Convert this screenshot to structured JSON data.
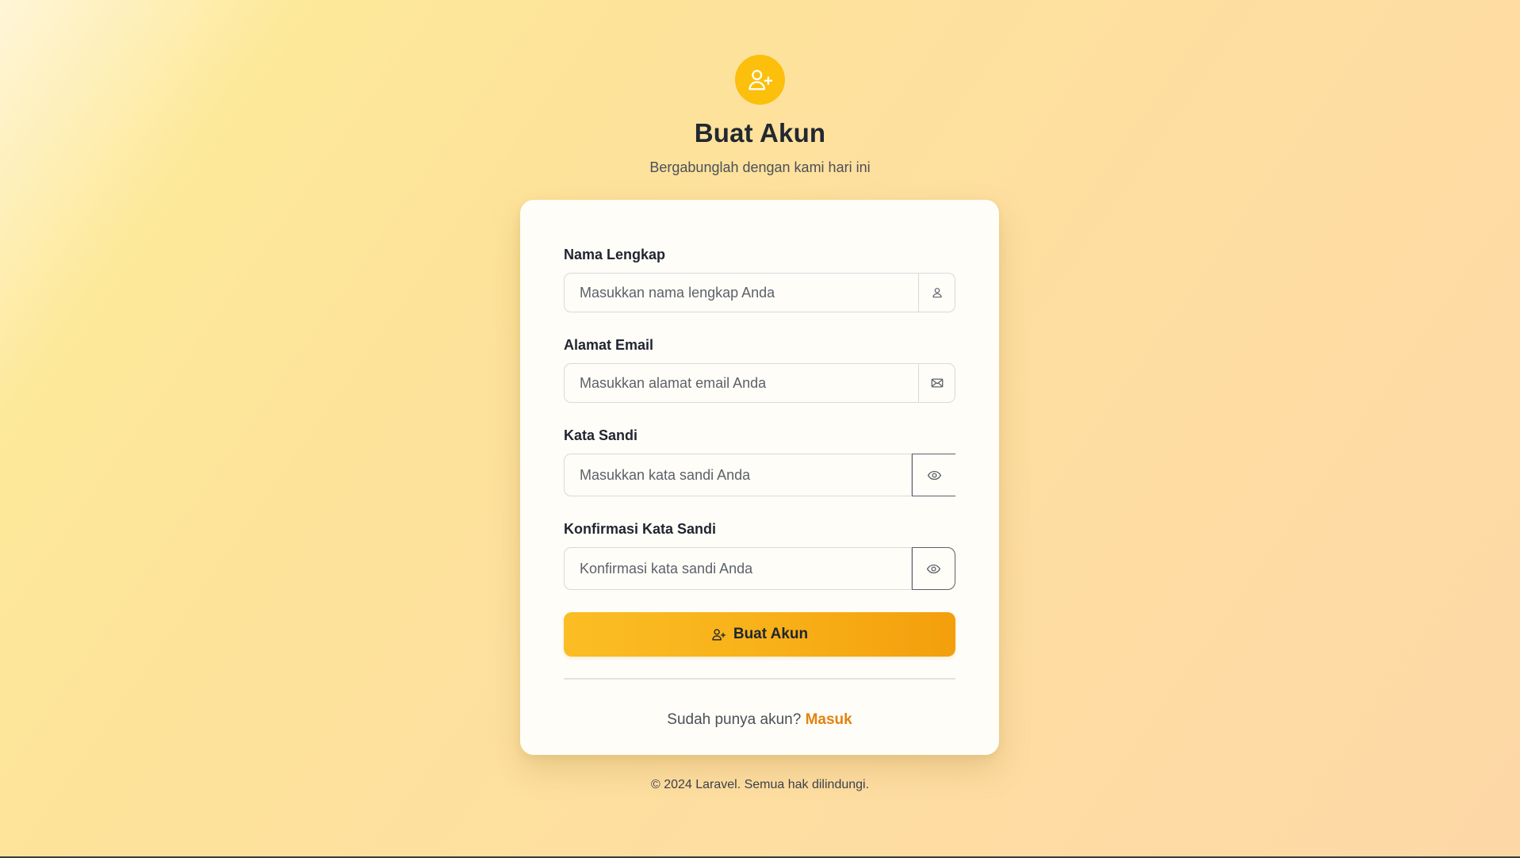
{
  "header": {
    "logo_icon": "user-plus-icon",
    "title": "Buat Akun",
    "subtitle": "Bergabunglah dengan kami hari ini"
  },
  "form": {
    "fields": [
      {
        "label": "Nama Lengkap",
        "placeholder": "Masukkan nama lengkap Anda",
        "value": "",
        "icon": "user-icon"
      },
      {
        "label": "Alamat Email",
        "placeholder": "Masukkan alamat email Anda",
        "value": "",
        "icon": "mail-icon"
      },
      {
        "label": "Kata Sandi",
        "placeholder": "Masukkan kata sandi Anda",
        "value": "",
        "icon": "eye-icon"
      },
      {
        "label": "Konfirmasi Kata Sandi",
        "placeholder": "Konfirmasi kata sandi Anda",
        "value": "",
        "icon": "eye-icon"
      }
    ],
    "submit_label": "Buat Akun",
    "submit_icon": "user-plus-icon",
    "login_prompt": "Sudah punya akun?",
    "login_link": "Masuk"
  },
  "footer": {
    "text": "© 2024 Laravel. Semua hak dilindungi."
  },
  "colors": {
    "accent": "#fbbf0c",
    "button_start": "#fbbd24",
    "button_end": "#f39f0c",
    "link": "#e08410",
    "card": "#fffdf7"
  }
}
